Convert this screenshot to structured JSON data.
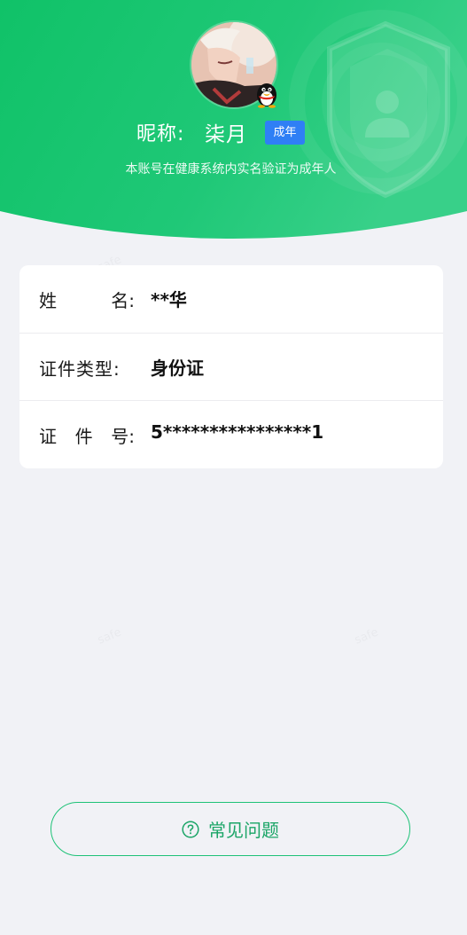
{
  "header": {
    "nickname_label": "昵称:",
    "nickname_value": "柒月",
    "age_badge": "成年",
    "verification_text": "本账号在健康系统内实名验证为成年人",
    "colors": {
      "gradient_start": "#12c36a",
      "gradient_end": "#34cf86",
      "badge_blue": "#2f7ff5"
    },
    "icons": {
      "avatar": "user-avatar",
      "qq_badge": "qq-penguin-icon",
      "shield": "shield-user-icon"
    }
  },
  "info": {
    "rows": [
      {
        "label_chars": [
          "姓",
          "名:"
        ],
        "value": "**华"
      },
      {
        "label": "证件类型:",
        "value": "身份证"
      },
      {
        "label_chars": [
          "证",
          "件",
          "号:"
        ],
        "value": "5****************1"
      }
    ]
  },
  "faq": {
    "label": "常见问题",
    "icon": "question-circle-icon",
    "color": "#1ec277"
  }
}
